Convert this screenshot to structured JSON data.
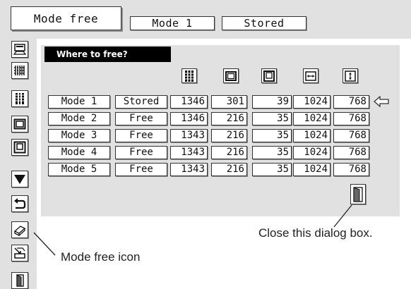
{
  "tabs": [
    {
      "label": "Mode free"
    },
    {
      "label": "Mode 1"
    },
    {
      "label": "Stored"
    }
  ],
  "sidebar": {
    "items": [
      {
        "icon": "monitor-position-icon"
      },
      {
        "icon": "fine-sync-icon"
      },
      {
        "icon": "total-dots-icon"
      },
      {
        "icon": "horizontal-position-icon"
      },
      {
        "icon": "vertical-position-icon"
      },
      {
        "icon": "scroll-down-icon"
      },
      {
        "icon": "reset-icon"
      },
      {
        "icon": "mode-free-icon"
      },
      {
        "icon": "store-icon"
      },
      {
        "icon": "quit-icon"
      }
    ]
  },
  "dialog": {
    "title": "Where to free?",
    "column_icons": [
      "total-dots-icon",
      "horizontal-position-icon",
      "vertical-position-icon",
      "display-width-icon",
      "display-height-icon"
    ],
    "rows": [
      {
        "name": "Mode 1",
        "status": "Stored",
        "values": [
          "1346",
          "301",
          "39",
          "1024",
          "768"
        ]
      },
      {
        "name": "Mode 2",
        "status": "Free",
        "values": [
          "1346",
          "216",
          "35",
          "1024",
          "768"
        ]
      },
      {
        "name": "Mode 3",
        "status": "Free",
        "values": [
          "1343",
          "216",
          "35",
          "1024",
          "768"
        ]
      },
      {
        "name": "Mode 4",
        "status": "Free",
        "values": [
          "1343",
          "216",
          "35",
          "1024",
          "768"
        ]
      },
      {
        "name": "Mode 5",
        "status": "Free",
        "values": [
          "1343",
          "216",
          "35",
          "1024",
          "768"
        ]
      }
    ],
    "selected_row_pointer": "left-arrow-icon",
    "close_icon": "door-icon"
  },
  "callouts": {
    "close": "Close this dialog box.",
    "mode_free": "Mode free icon"
  },
  "colors": {
    "panel": "#e1e1e1",
    "title_bar": "#000000",
    "cell": "#ffffff"
  }
}
